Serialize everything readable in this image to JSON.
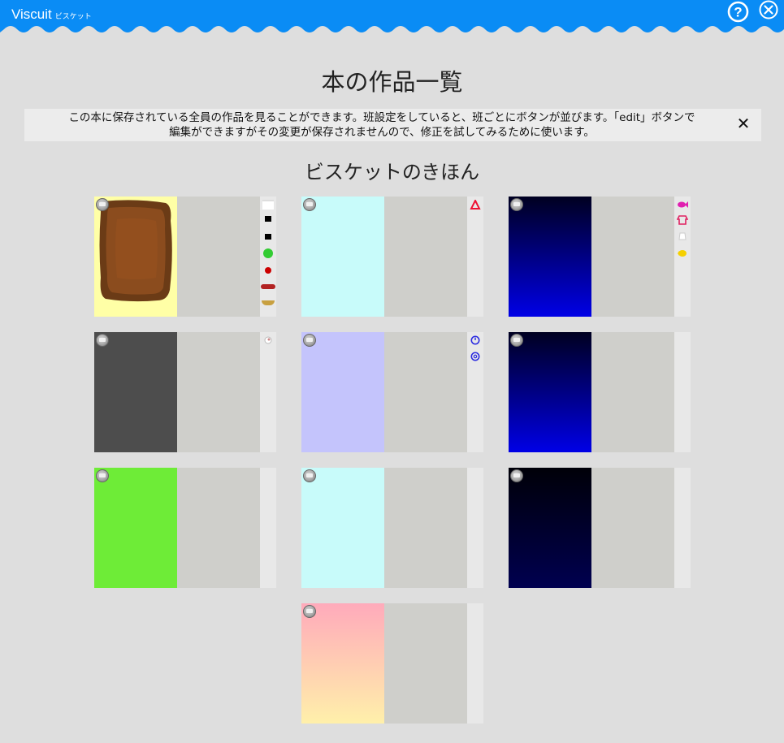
{
  "app": {
    "title": "Viscuit",
    "subtitle": "ビスケット"
  },
  "colors": {
    "header": "#0a8cf5",
    "background": "#dedede"
  },
  "header": {
    "help_icon": "question-circle-icon",
    "close_icon": "close-circle-icon"
  },
  "page": {
    "title": "本の作品一覧",
    "notice_line1": "この本に保存されている全員の作品を見ることができます。班設定をしていると、班ごとにボタンが並びます。「edit」ボタンで",
    "notice_line2": "編集ができますがその変更が保存されませんので、修正を試してみるために使います。",
    "notice_close": "✕",
    "section_title": "ビスケットのきほん"
  },
  "works": [
    {
      "id": 1,
      "stage": "#ffffa6",
      "palette": [
        "picture",
        "black-square",
        "black-small",
        "green-circle",
        "red-dot",
        "red-oval",
        "bowl"
      ]
    },
    {
      "id": 2,
      "stage": "#c8fbfa",
      "palette": [
        "red-triangle"
      ]
    },
    {
      "id": 3,
      "stage": "gradient-dark-blue",
      "palette": [
        "pink-fish",
        "pink-shirt",
        "white-pot",
        "yellow-fish"
      ]
    },
    {
      "id": 4,
      "stage": "#4d4d4d",
      "palette": [
        "tiny-figure"
      ]
    },
    {
      "id": 5,
      "stage": "#c4c4fc",
      "palette": [
        "blue-spiral",
        "blue-spiral-2"
      ]
    },
    {
      "id": 6,
      "stage": "gradient-dark-blue",
      "palette": []
    },
    {
      "id": 7,
      "stage": "#6eec37",
      "palette": []
    },
    {
      "id": 8,
      "stage": "#c8fbfa",
      "palette": []
    },
    {
      "id": 9,
      "stage": "gradient-navy",
      "palette": []
    },
    {
      "id": 10,
      "stage": "gradient-pink-yellow",
      "palette": []
    }
  ]
}
